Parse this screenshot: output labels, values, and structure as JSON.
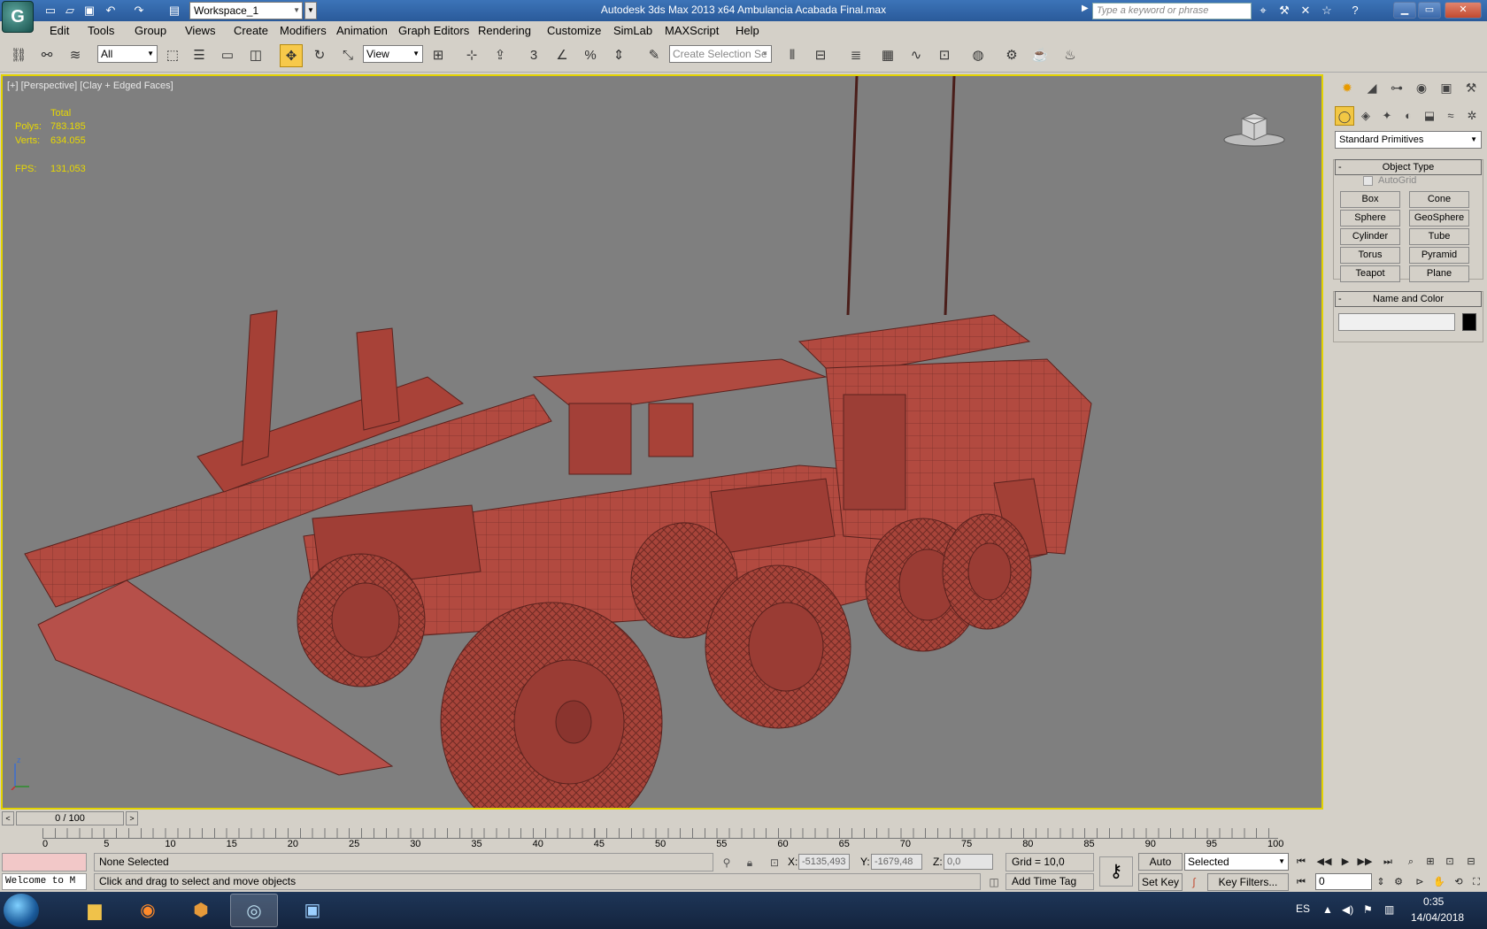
{
  "titlebar": {
    "window_title": "Autodesk 3ds Max  2013 x64     Ambulancia Acabada Final.max",
    "workspace": "Workspace_1",
    "search_placeholder": "Type a keyword or phrase"
  },
  "menu": [
    "Edit",
    "Tools",
    "Group",
    "Views",
    "Create",
    "Modifiers",
    "Animation",
    "Graph Editors",
    "Rendering",
    "Customize",
    "SimLab",
    "MAXScript",
    "Help"
  ],
  "toolbar": {
    "selection_filter": "All",
    "ref_coord": "View",
    "named_selection": "Create Selection Se"
  },
  "viewport": {
    "label": "[+] [Perspective] [Clay + Edged Faces]",
    "stats": {
      "total_label": "Total",
      "polys_label": "Polys:",
      "polys": "783.185",
      "verts_label": "Verts:",
      "verts": "634.055",
      "fps_label": "FPS:",
      "fps": "131,053"
    },
    "axis_z": "z",
    "model_color": "#b24a40"
  },
  "command_panel": {
    "category": "Standard Primitives",
    "object_type_title": "Object Type",
    "autogrid": "AutoGrid",
    "primitives": [
      "Box",
      "Cone",
      "Sphere",
      "GeoSphere",
      "Cylinder",
      "Tube",
      "Torus",
      "Pyramid",
      "Teapot",
      "Plane"
    ],
    "name_color_title": "Name and Color"
  },
  "timeline": {
    "frame_display": "0 / 100",
    "ticks": [
      "0",
      "5",
      "10",
      "15",
      "20",
      "25",
      "30",
      "35",
      "40",
      "45",
      "50",
      "55",
      "60",
      "65",
      "70",
      "75",
      "80",
      "85",
      "90",
      "95",
      "100"
    ]
  },
  "status": {
    "maxscript": "Welcome to M",
    "selection": "None Selected",
    "prompt": "Click and drag to select and move objects",
    "x_label": "X:",
    "x_value": "-5135,493",
    "y_label": "Y:",
    "y_value": "-1679,48",
    "z_label": "Z:",
    "z_value": "0,0",
    "grid": "Grid = 10,0",
    "add_time_tag": "Add Time Tag",
    "auto_key": "Auto Key",
    "set_key": "Set Key",
    "key_mode": "Selected",
    "key_filters": "Key Filters...",
    "frame": "0"
  },
  "taskbar": {
    "language": "ES",
    "time": "0:35",
    "date": "14/04/2018"
  }
}
